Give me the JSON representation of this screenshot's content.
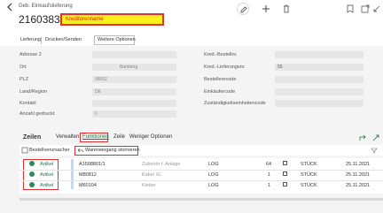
{
  "header": {
    "breadcrumb": "Geb. Einkaufslieferung",
    "document_no": "21603835",
    "vendor_name": "Kreditorenname"
  },
  "actions": {
    "items": [
      "Lieferung",
      "Drucken/Senden",
      "Weitere Optionen"
    ]
  },
  "form": {
    "left": [
      {
        "label": "Adresse 2",
        "value": ""
      },
      {
        "label": "Ort",
        "value": "Bamberg"
      },
      {
        "label": "PLZ",
        "value": "96052"
      },
      {
        "label": "Land/Region",
        "value": "DE"
      },
      {
        "label": "Kontakt",
        "value": ""
      },
      {
        "label": "Anzahl gedruckt",
        "value": "0"
      }
    ],
    "right": [
      {
        "label": "Kred.-Bestellnr.",
        "value": ""
      },
      {
        "label": "Kred.-Lieferungsnr.",
        "value": "55"
      },
      {
        "label": "Bestellerecode",
        "value": ""
      },
      {
        "label": "Einkäufercode",
        "value": ""
      },
      {
        "label": "Zuständigkeitseinheitencode",
        "value": ""
      }
    ]
  },
  "lines": {
    "tabs": [
      "Zeilen",
      "Verwalten",
      "Funktionen",
      "Zeile",
      "Weniger Optionen"
    ],
    "sub_actions": [
      "Bestellverursacher",
      "Wareneingang stornieren"
    ],
    "rows": [
      {
        "type": "Artikel",
        "no": "A1508801/1",
        "desc": "Zubehör f. Anlage",
        "loc": "LOG",
        "qty": "64",
        "unit": "STÜCK",
        "date": "25.11.2021"
      },
      {
        "type": "Artikel",
        "no": "M80812",
        "desc": "Kabel XL",
        "loc": "LOG",
        "qty": "1",
        "unit": "STÜCK",
        "date": "25.11.2021"
      },
      {
        "type": "Artikel",
        "no": "M60104",
        "desc": "Kleber",
        "loc": "LOG",
        "qty": "1",
        "unit": "STÜCK",
        "date": "25.11.2021"
      }
    ]
  },
  "colors": {
    "accent": "#107c41",
    "highlight": "#ffef1a",
    "outline": "#e03030"
  }
}
